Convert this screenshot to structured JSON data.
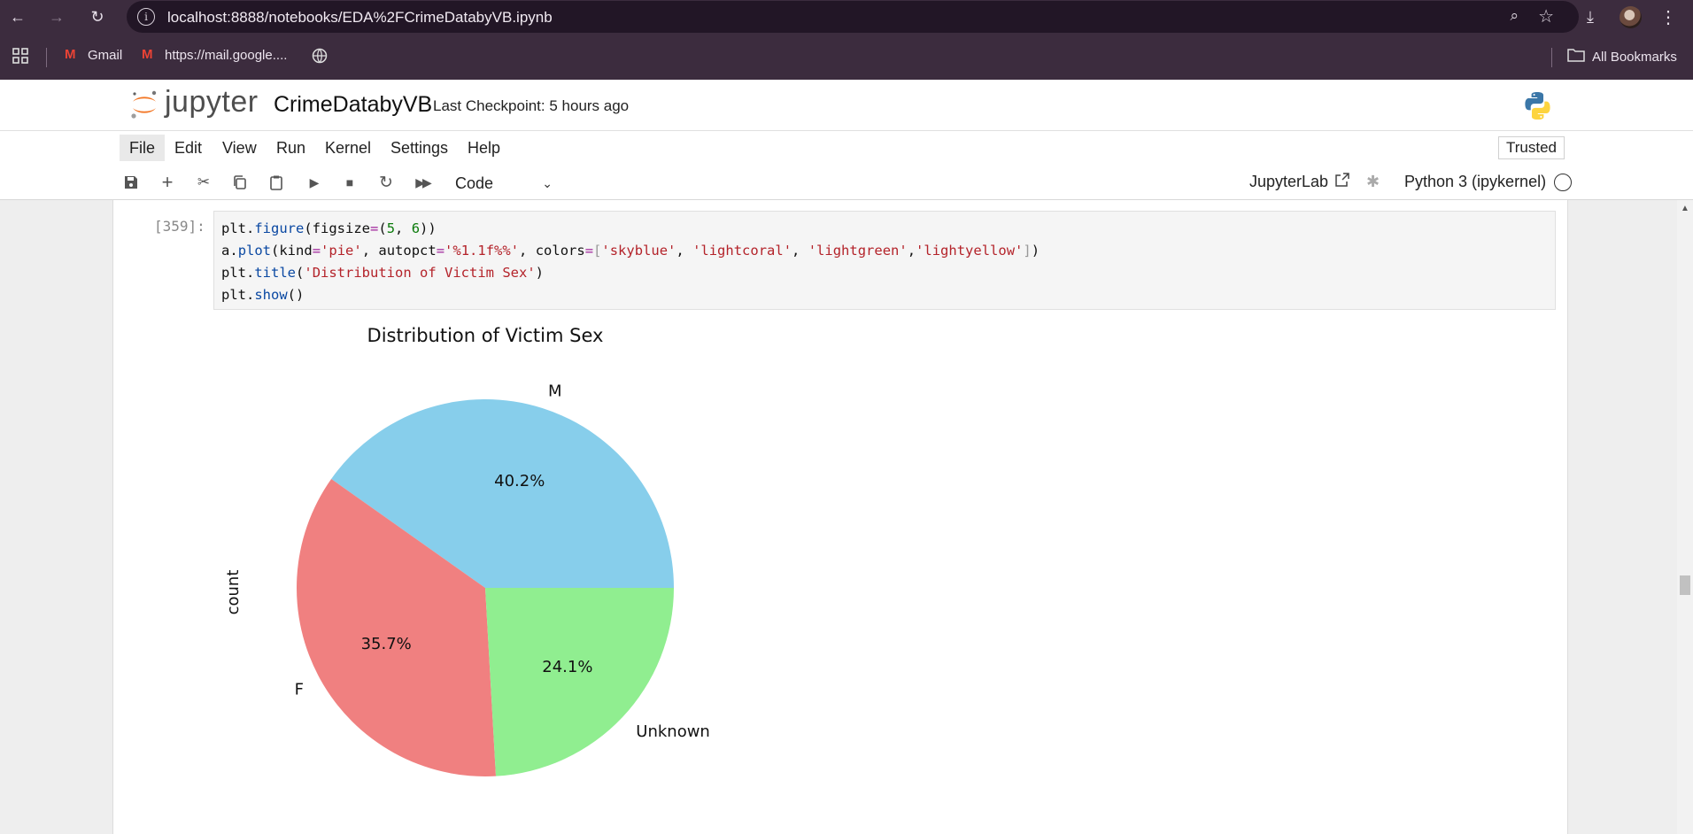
{
  "browser": {
    "url": "localhost:8888/notebooks/EDA%2FCrimeDatabyVB.ipynb",
    "bookmarks": [
      {
        "label": "Gmail"
      },
      {
        "label": "https://mail.google...."
      }
    ],
    "all_bookmarks": "All Bookmarks"
  },
  "jupyter": {
    "logo_text": "jupyter",
    "notebook_title": "CrimeDatabyVB",
    "checkpoint": "Last Checkpoint: 5 hours ago",
    "menu": [
      "File",
      "Edit",
      "View",
      "Run",
      "Kernel",
      "Settings",
      "Help"
    ],
    "trusted": "Trusted",
    "cell_type": "Code",
    "jupyterlab": "JupyterLab",
    "kernel": "Python 3 (ipykernel)"
  },
  "cell": {
    "prompt": "[359]:",
    "code_lines": [
      "plt.figure(figsize=(5, 6))",
      "a.plot(kind='pie', autopct='%1.1f%%', colors=['skyblue', 'lightcoral', 'lightgreen','lightyellow'])",
      "plt.title('Distribution of Victim Sex')",
      "plt.show()"
    ]
  },
  "chart_data": {
    "type": "pie",
    "title": "Distribution of Victim Sex",
    "ylabel": "count",
    "categories": [
      "M",
      "F",
      "Unknown"
    ],
    "values": [
      40.2,
      35.7,
      24.1
    ],
    "value_labels": [
      "40.2%",
      "35.7%",
      "24.1%"
    ],
    "colors": [
      "#87ceeb",
      "#f08080",
      "#90ee90"
    ],
    "start_angle_deg": 0,
    "direction": "counterclockwise"
  }
}
